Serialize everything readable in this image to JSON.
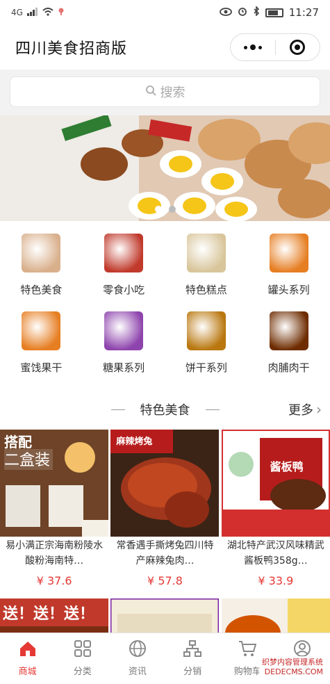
{
  "status": {
    "network": "4G",
    "time": "11:27"
  },
  "nav": {
    "title": "四川美食招商版"
  },
  "search": {
    "placeholder": "搜索"
  },
  "categories": [
    {
      "label": "特色美食",
      "color": "#d9b08c"
    },
    {
      "label": "零食小吃",
      "color": "#c0392b"
    },
    {
      "label": "特色糕点",
      "color": "#d8c59a"
    },
    {
      "label": "罐头系列",
      "color": "#e67e22"
    },
    {
      "label": "蜜饯果干",
      "color": "#e67e22"
    },
    {
      "label": "糖果系列",
      "color": "#8e44ad"
    },
    {
      "label": "饼干系列",
      "color": "#b9770e"
    },
    {
      "label": "肉脯肉干",
      "color": "#6e2c00"
    }
  ],
  "section": {
    "title": "特色美食",
    "more": "更多"
  },
  "products": [
    {
      "name": "易小满正宗海南粉陵水酸粉海南特…",
      "price": "¥ 37.6",
      "badge": "搭配",
      "sub": "二盒装"
    },
    {
      "name": "常香遇手撕烤兔四川特产麻辣兔肉…",
      "price": "¥ 57.8",
      "badge": "麻辣烤兔"
    },
    {
      "name": "湖北特产武汉风味精武酱板鸭358g…",
      "price": "¥ 33.9",
      "badge": "酱板鸭"
    }
  ],
  "products_row2_badges": {
    "first": "送！送！送！"
  },
  "tabbar": [
    {
      "label": "商城",
      "icon": "home-icon",
      "active": true
    },
    {
      "label": "分类",
      "icon": "grid-icon",
      "active": false
    },
    {
      "label": "资讯",
      "icon": "globe-icon",
      "active": false
    },
    {
      "label": "分销",
      "icon": "network-icon",
      "active": false
    },
    {
      "label": "购物车",
      "icon": "cart-icon",
      "active": false
    },
    {
      "label": "我的",
      "icon": "user-icon",
      "active": false
    }
  ],
  "watermark": {
    "line1": "织梦内容管理系统",
    "line2": "DEDECMS.COM"
  },
  "colors": {
    "accent": "#e53935",
    "price": "#e53935"
  }
}
